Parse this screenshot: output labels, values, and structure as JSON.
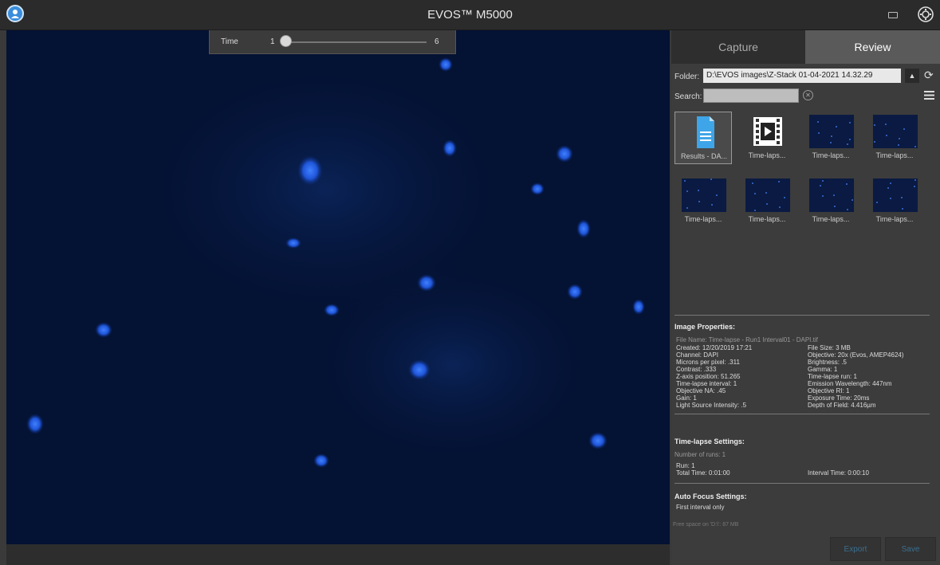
{
  "window": {
    "title": "EVOS™ M5000"
  },
  "icons": {
    "user": "user-icon",
    "camera": "camera-icon",
    "settings": "gear-icon"
  },
  "time": {
    "label": "Time",
    "min": "1",
    "max": "6",
    "value": 1
  },
  "tabs": [
    {
      "label": "Capture",
      "active": false
    },
    {
      "label": "Review",
      "active": true
    }
  ],
  "review": {
    "folder_label": "Folder:",
    "folder_value": "D:\\EVOS images\\Z-Stack 01-04-2021 14.32.29",
    "search_label": "Search:",
    "search_value": ""
  },
  "thumbnails": [
    {
      "caption": "Results - DA...",
      "kind": "document"
    },
    {
      "caption": "Time-laps...",
      "kind": "video"
    },
    {
      "caption": "Time-laps...",
      "kind": "image"
    },
    {
      "caption": "Time-laps...",
      "kind": "image"
    },
    {
      "caption": "Time-laps...",
      "kind": "image"
    },
    {
      "caption": "Time-laps...",
      "kind": "image"
    },
    {
      "caption": "Time-laps...",
      "kind": "image"
    },
    {
      "caption": "Time-laps...",
      "kind": "image"
    }
  ],
  "image_properties": {
    "title": "Image Properties:",
    "file_name": "File Name: Time-lapse - Run1 Interval01 - DAPI.tif",
    "left": [
      "Created: 12/20/2019 17:21",
      "Channel: DAPI",
      "Microns per pixel: .311",
      "Contrast: .333",
      "Z-axis position: 51.265",
      "Time-lapse interval: 1",
      "Objective NA: .45",
      "Gain: 1",
      "Light Source Intensity: .5"
    ],
    "right": [
      "File Size: 3 MB",
      "Objective: 20x (Evos, AMEP4624)",
      "Brightness: .5",
      "Gamma: 1",
      "Time-lapse run: 1",
      "Emission Wavelength: 447nm",
      "Objective RI: 1",
      "Exposure Time: 20ms",
      "Depth of Field: 4.416µm"
    ]
  },
  "timelapse_settings": {
    "title": "Time-lapse Settings:",
    "number_of_runs": "Number of runs: 1",
    "run": "Run: 1",
    "total_time": "Total Time: 0:01:00",
    "interval_time": "Interval Time: 0:00:10"
  },
  "autofocus_settings": {
    "title": "Auto Focus Settings:",
    "value": "First interval only"
  },
  "free_space": "Free space on 'D:\\': 87 MB",
  "buttons": {
    "export": "Export",
    "save": "Save"
  },
  "colors": {
    "accent": "#3a8ddc",
    "nucleus": "#2f6bff",
    "background": "#041233"
  }
}
